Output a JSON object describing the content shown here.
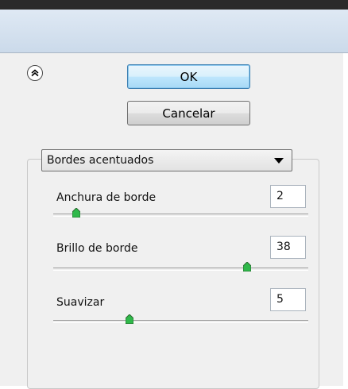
{
  "dialog": {
    "ok_label": "OK",
    "cancel_label": "Cancelar",
    "collapse_icon": "chevron-up-icon"
  },
  "filter": {
    "selected": "Bordes acentuados"
  },
  "params": [
    {
      "label": "Anchura de borde",
      "value": "2",
      "slider_fraction": 0.09
    },
    {
      "label": "Brillo de borde",
      "value": "38",
      "slider_fraction": 0.76
    },
    {
      "label": "Suavizar",
      "value": "5",
      "slider_fraction": 0.3
    }
  ],
  "colors": {
    "ok_border": "#3c7fb1",
    "thumb_fill": "#2fb84a"
  }
}
